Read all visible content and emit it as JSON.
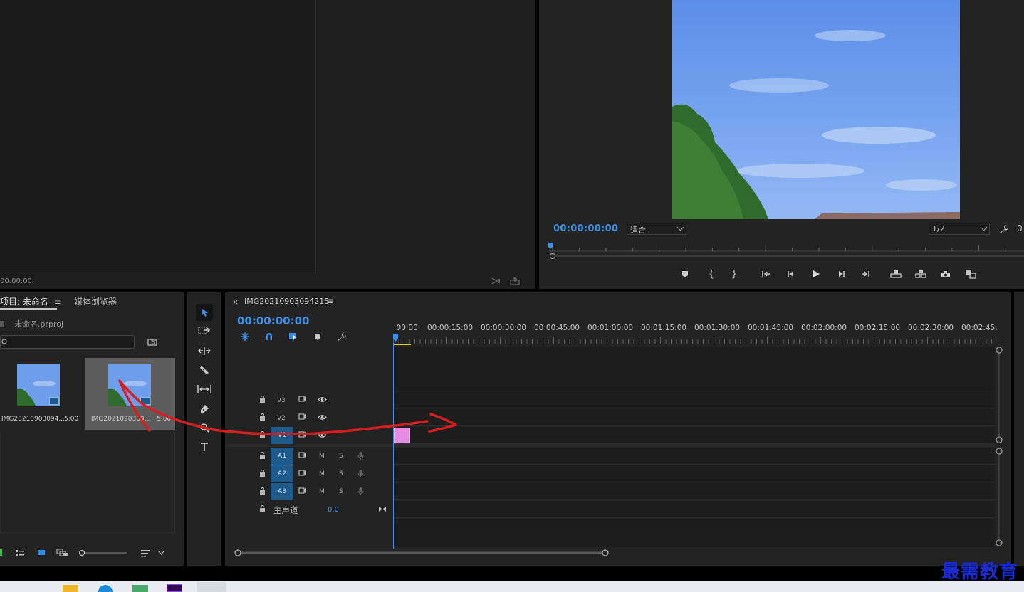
{
  "source_monitor": {
    "timecode": "00:00:00"
  },
  "program_monitor": {
    "timecode": "00:00:00:00",
    "zoom_select": "适合",
    "resolution_select": "1/2",
    "extra_value": "0"
  },
  "project_panel": {
    "tab_label": "项目: 未命名",
    "media_browser_label": "媒体浏览器",
    "project_file": "未命名.prproj",
    "clips": [
      {
        "name": "IMG20210903094...",
        "duration": "5:00"
      },
      {
        "name": "IMG2021090309...",
        "duration": "5:00"
      }
    ]
  },
  "timeline": {
    "sequence_name": "IMG20210903094215",
    "timecode": "00:00:00:00",
    "ruler_labels": [
      ":00:00",
      "00:00:15:00",
      "00:00:30:00",
      "00:00:45:00",
      "00:01:00:00",
      "00:01:15:00",
      "00:01:30:00",
      "00:01:45:00",
      "00:02:00:00",
      "00:02:15:00",
      "00:02:30:00",
      "00:02:45:"
    ],
    "video_tracks": [
      "V3",
      "V2",
      "V1"
    ],
    "audio_tracks": [
      "A1",
      "A2",
      "A3"
    ],
    "mute_label": "M",
    "solo_label": "S",
    "master_label": "主声道",
    "master_value": "0.0"
  },
  "watermark": "最需教育",
  "colors": {
    "accent": "#3b8fe6",
    "clip": "#e58be0",
    "annotation": "#d81f1f",
    "panel": "#232323"
  }
}
